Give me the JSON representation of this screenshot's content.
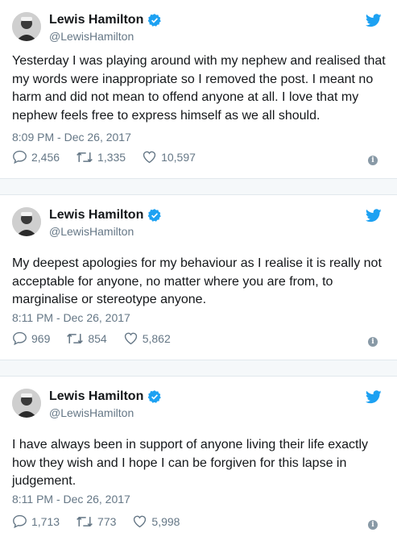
{
  "tweets": [
    {
      "name": "Lewis Hamilton",
      "handle": "@LewisHamilton",
      "text": "Yesterday I was playing around with my nephew and realised that my words were inappropriate so I removed the post. I meant no harm and did not mean to offend anyone at all. I love that my nephew feels free to express himself as we all should.",
      "time": "8:09 PM - Dec 26, 2017",
      "replies": "2,456",
      "retweets": "1,335",
      "likes": "10,597"
    },
    {
      "name": "Lewis Hamilton",
      "handle": "@LewisHamilton",
      "text": "My deepest apologies for my behaviour as I realise it is really not acceptable for anyone, no matter where you are from, to marginalise or stereotype anyone.",
      "time": "8:11 PM - Dec 26, 2017",
      "replies": "969",
      "retweets": "854",
      "likes": "5,862"
    },
    {
      "name": "Lewis Hamilton",
      "handle": "@LewisHamilton",
      "text": "I have always been in support of anyone living their life exactly how they wish and I hope I can be forgiven for this lapse in judgement.",
      "time": "8:11 PM - Dec 26, 2017",
      "replies": "1,713",
      "retweets": "773",
      "likes": "5,998"
    }
  ],
  "icons": {
    "verified": "verified-badge-icon",
    "bird": "twitter-bird-icon",
    "reply": "reply-icon",
    "retweet": "retweet-icon",
    "like": "heart-icon",
    "info": "info-icon"
  },
  "colors": {
    "twitter_blue": "#1da1f2",
    "secondary_text": "#657786",
    "separator": "#f5f8fa"
  }
}
